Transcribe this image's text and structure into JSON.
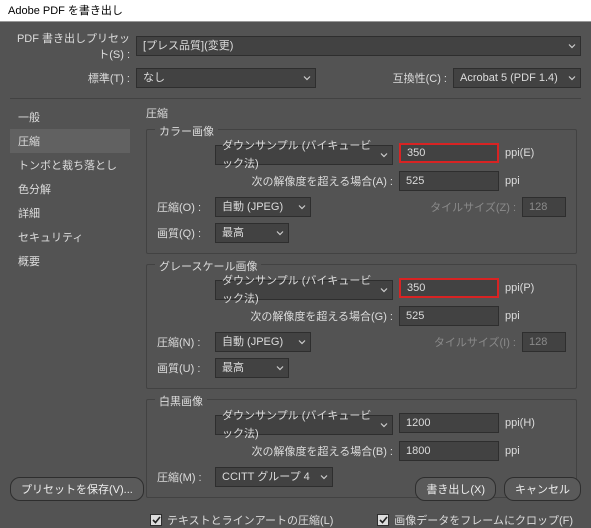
{
  "window": {
    "title": "Adobe PDF を書き出し"
  },
  "top": {
    "presetLabel": "PDF 書き出しプリセット(S) :",
    "presetValue": "[プレス品質](変更)",
    "standardLabel": "標準(T) :",
    "standardValue": "なし",
    "compatLabel": "互換性(C) :",
    "compatValue": "Acrobat 5 (PDF 1.4)"
  },
  "side": {
    "items": [
      "一般",
      "圧縮",
      "トンボと裁ち落とし",
      "色分解",
      "詳細",
      "セキュリティ",
      "概要"
    ],
    "activeIndex": 1
  },
  "main": {
    "heading": "圧縮",
    "color": {
      "legend": "カラー画像",
      "downsample": "ダウンサンプル (バイキュービック法)",
      "ppi": "350",
      "ppiUnit": "ppi(E)",
      "thresholdLabel": "次の解像度を超える場合(A) :",
      "threshold": "525",
      "thresholdUnit": "ppi",
      "compLabel": "圧縮(O) :",
      "compValue": "自動 (JPEG)",
      "tileLabel": "タイルサイズ(Z) :",
      "tileValue": "128",
      "qualityLabel": "画質(Q) :",
      "qualityValue": "最高"
    },
    "gray": {
      "legend": "グレースケール画像",
      "downsample": "ダウンサンプル (バイキュービック法)",
      "ppi": "350",
      "ppiUnit": "ppi(P)",
      "thresholdLabel": "次の解像度を超える場合(G) :",
      "threshold": "525",
      "thresholdUnit": "ppi",
      "compLabel": "圧縮(N) :",
      "compValue": "自動 (JPEG)",
      "tileLabel": "タイルサイズ(I) :",
      "tileValue": "128",
      "qualityLabel": "画質(U) :",
      "qualityValue": "最高"
    },
    "mono": {
      "legend": "白黒画像",
      "downsample": "ダウンサンプル (バイキュービック法)",
      "ppi": "1200",
      "ppiUnit": "ppi(H)",
      "thresholdLabel": "次の解像度を超える場合(B) :",
      "threshold": "1800",
      "thresholdUnit": "ppi",
      "compLabel": "圧縮(M) :",
      "compValue": "CCITT グループ 4"
    },
    "checks": {
      "textArt": "テキストとラインアートの圧縮(L)",
      "crop": "画像データをフレームにクロップ(F)"
    }
  },
  "footer": {
    "savePreset": "プリセットを保存(V)...",
    "export": "書き出し(X)",
    "cancel": "キャンセル"
  }
}
